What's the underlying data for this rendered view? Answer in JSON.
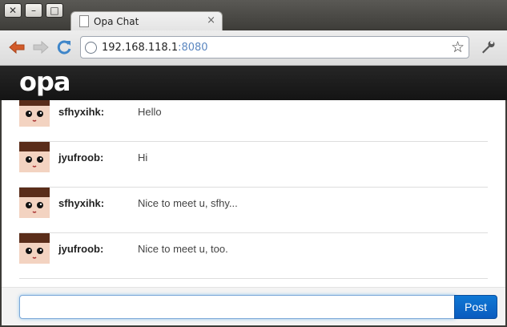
{
  "window": {
    "close_glyph": "✕",
    "minimize_glyph": "–",
    "maximize_glyph": "□"
  },
  "tab": {
    "title": "Opa Chat",
    "close_glyph": "×"
  },
  "toolbar": {
    "back_icon": "back-arrow-icon",
    "forward_icon": "forward-arrow-icon",
    "reload_icon": "reload-icon",
    "url_host": "192.168.118.1",
    "url_port": ":8080",
    "star_glyph": "☆",
    "wrench_glyph": "🔧"
  },
  "app": {
    "logo": "opa"
  },
  "messages": [
    {
      "author": "sfhyxihk:",
      "text": "Hello"
    },
    {
      "author": "jyufroob:",
      "text": "Hi"
    },
    {
      "author": "sfhyxihk:",
      "text": "Nice to meet u, sfhy..."
    },
    {
      "author": "jyufroob:",
      "text": "Nice to meet u, too."
    }
  ],
  "composer": {
    "value": "",
    "post_label": "Post"
  },
  "colors": {
    "accent": "#0b66c7",
    "header_bg": "#1c1c1c",
    "back_arrow": "#d35b2a",
    "reload": "#3f86c9"
  }
}
